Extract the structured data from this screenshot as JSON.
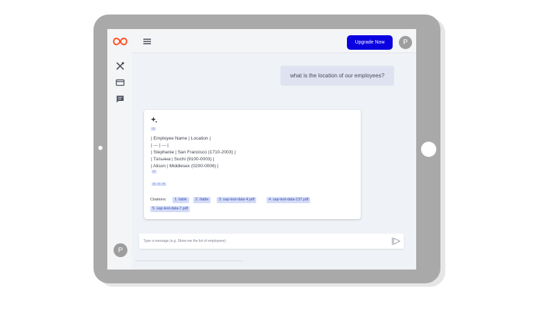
{
  "header": {
    "upgrade_label": "Upgrade Now",
    "avatar_initial": "P"
  },
  "sidebar": {
    "avatar_initial": "P"
  },
  "chat": {
    "user_message": "what is the location of our employees?",
    "bot": {
      "ref_top": "1",
      "table_lines": [
        "| Employee Name | Location |",
        "| --- | --- |",
        "| Stephanie | San Francisco (1710-2003) |",
        "| Татьяна | Sochi (9100-0003) |",
        "| Alison | Middlesex (0200-0006) |"
      ],
      "ref_after_table": "2",
      "refs_row": [
        "3",
        "4",
        "5"
      ],
      "citations_label": "Citations:",
      "citations": [
        "1. table",
        "2. /table",
        "3. sap-test-data-4.pdf",
        "4. sap-test-data-137.pdf",
        "5. sap-test-data-7.pdf"
      ]
    }
  },
  "composer": {
    "placeholder": "Type a message (e.g. Show me the list of employees)"
  },
  "colors": {
    "accent": "#0a00e0",
    "logo": "#ff4a1c",
    "chip_bg": "#d3dbf8",
    "frame": "#a9a9a9"
  },
  "icons": [
    "infinity-logo",
    "tools-icon",
    "card-icon",
    "chat-icon",
    "menu-icon",
    "sparkle-icon",
    "send-icon"
  ]
}
